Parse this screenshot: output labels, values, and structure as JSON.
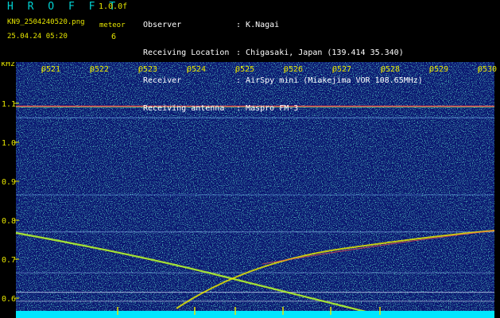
{
  "app": {
    "title": "H R O F F T",
    "version": "1.0.0f",
    "filename": "KN9_2504240520.png",
    "label": "meteor",
    "count": "6",
    "datetime": "25.04.24 05:20"
  },
  "info": [
    {
      "key": "Observer",
      "value": "K.Nagai"
    },
    {
      "key": "Receiving Location",
      "value": "Chigasaki, Japan (139.414 35.340)"
    },
    {
      "key": "Receiver",
      "value": "AirSpy mini (Miakejima VOR 108.65MHz)"
    },
    {
      "key": "Receiving antenna",
      "value": "Maspro FM-3"
    }
  ],
  "spectrogram": {
    "unit": "kHz",
    "time_labels": [
      "0521",
      "0522",
      "0523",
      "0524",
      "0525",
      "0526",
      "0527",
      "0528",
      "0529",
      "0530"
    ],
    "freq_labels": [
      "1.1",
      "1.0",
      "0.9",
      "0.8",
      "0.7",
      "0.6"
    ],
    "freq_values": [
      1.1,
      1.0,
      0.9,
      0.8,
      0.7,
      0.6
    ],
    "background": "#0a1470",
    "trace_color": "#e6e600",
    "strong_line_color": "#ff4d4d",
    "baseline_color": "#00e6ff"
  }
}
